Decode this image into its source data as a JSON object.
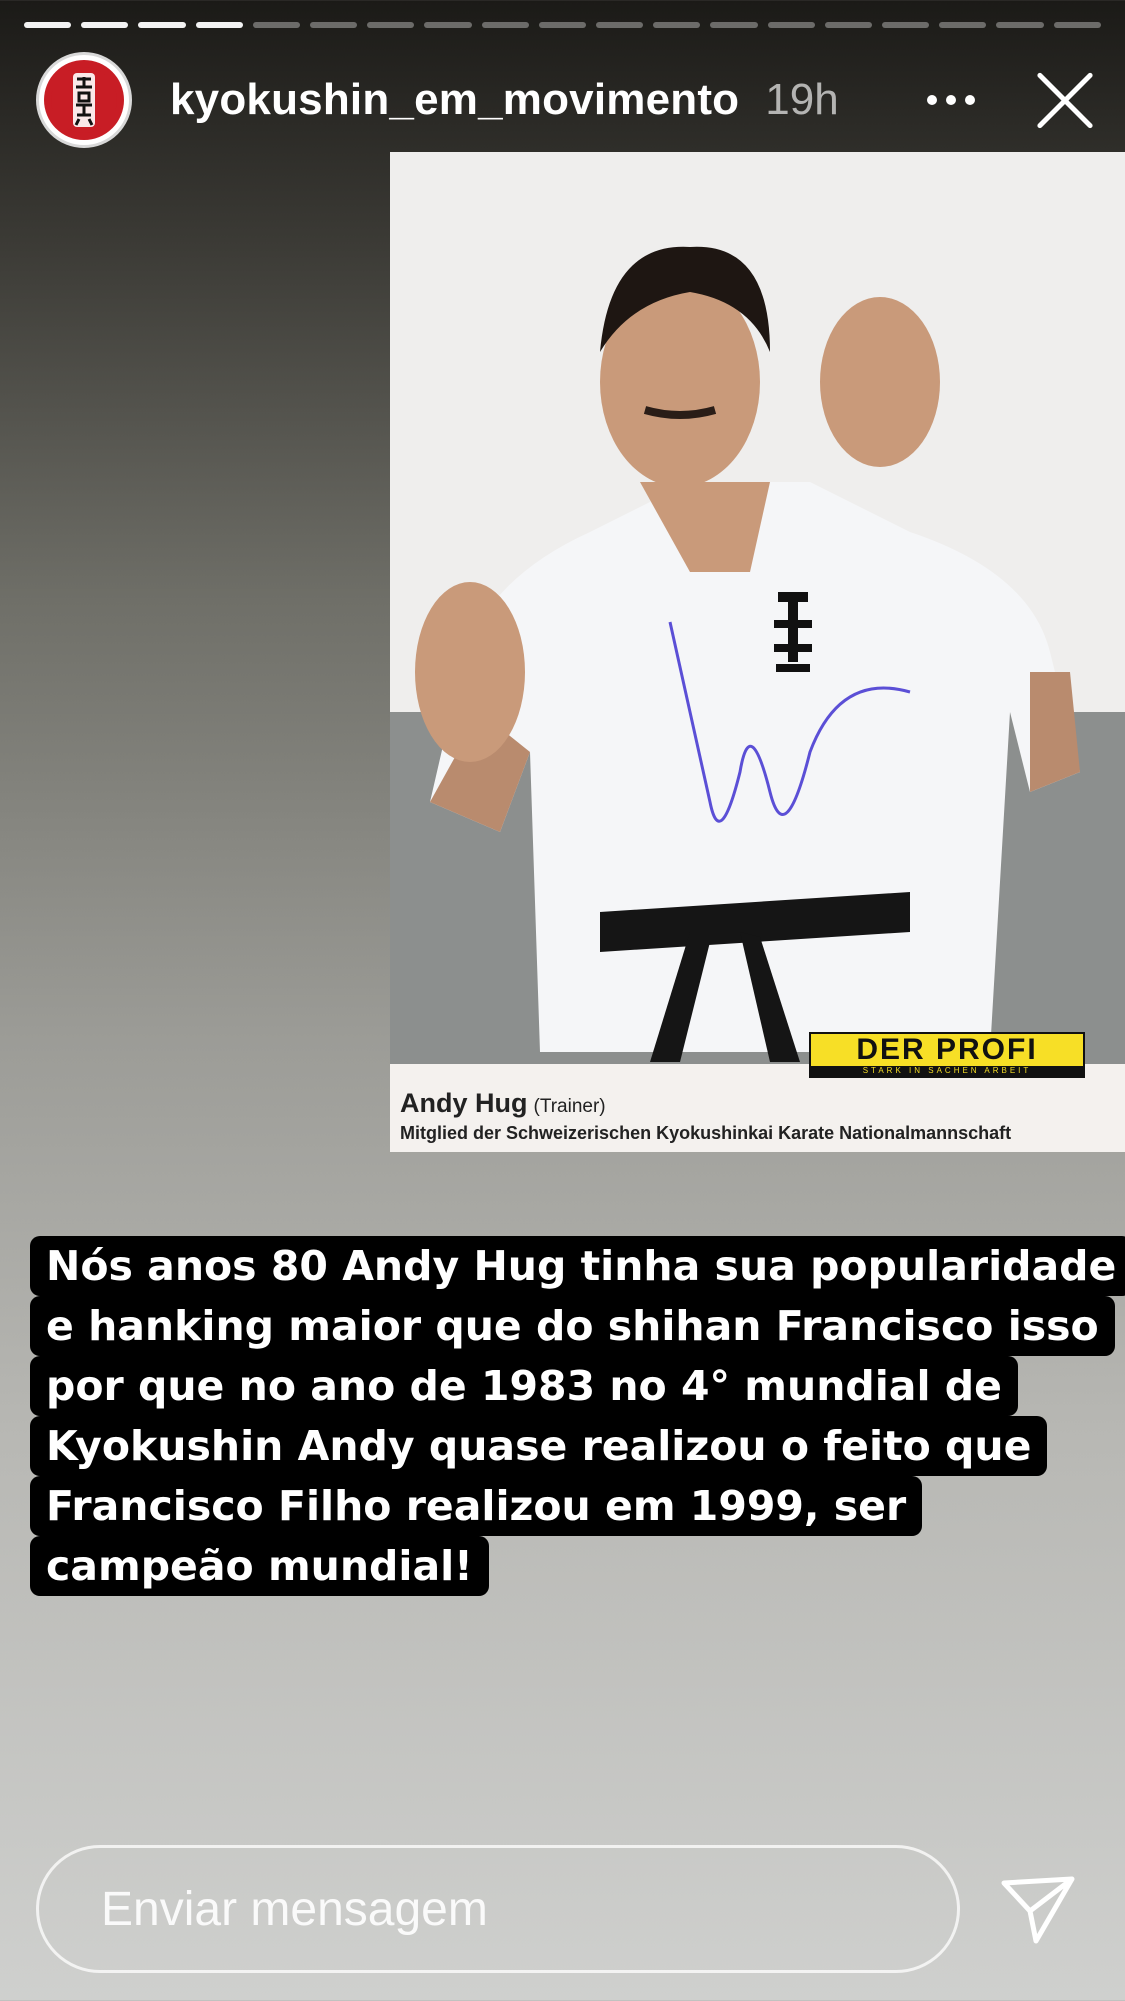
{
  "story": {
    "progress_total": 19,
    "progress_done": 4,
    "username": "kyokushin_em_movimento",
    "time_ago": "19h"
  },
  "photo": {
    "badge": "DER PROFI",
    "badge_tagline": "STARK IN SACHEN ARBEIT",
    "caption_name": "Andy Hug",
    "caption_role": "(Trainer)",
    "caption_sub": "Mitglied der Schweizerischen Kyokushinkai Karate Nationalmannschaft"
  },
  "text_lines": [
    "Nós anos 80 Andy Hug tinha sua popularidade",
    "e hanking maior que do shihan Francisco isso",
    "por que no ano de 1983 no 4° mundial de",
    "Kyokushin Andy quase realizou o feito que",
    "Francisco Filho realizou em 1999, ser",
    "campeão mundial!"
  ],
  "composer": {
    "placeholder": "Enviar mensagem"
  },
  "icons": {
    "more": "more-horizontal-icon",
    "close": "close-icon",
    "send": "send-paper-plane-icon"
  }
}
